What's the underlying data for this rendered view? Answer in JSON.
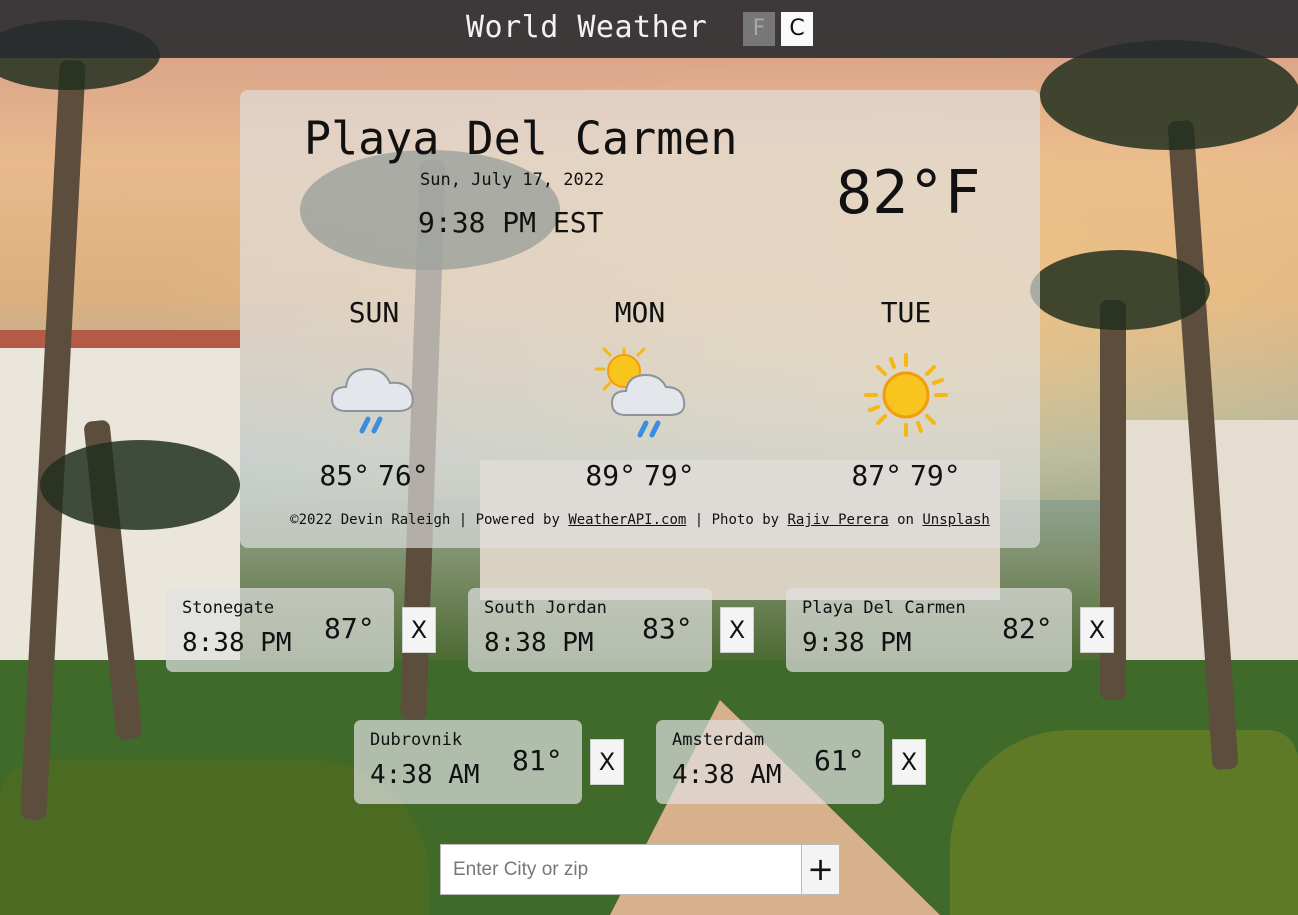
{
  "header": {
    "title": "World Weather",
    "unit_f": "F",
    "unit_c": "C",
    "active_unit": "F"
  },
  "current": {
    "city": "Playa Del Carmen",
    "date": "Sun, July 17, 2022",
    "time": "9:38 PM EST",
    "temp": "82°F"
  },
  "forecast": [
    {
      "day": "SUN",
      "icon": "rain-cloud-icon",
      "hi": "85°",
      "lo": "76°"
    },
    {
      "day": "MON",
      "icon": "sun-cloud-rain-icon",
      "hi": "89°",
      "lo": "79°"
    },
    {
      "day": "TUE",
      "icon": "sun-icon",
      "hi": "87°",
      "lo": "79°"
    }
  ],
  "footer": {
    "prefix": "©2022 Devin Raleigh | Powered by ",
    "api_link": "WeatherAPI.com",
    "photo_text": " | Photo by ",
    "photographer_link": "Rajiv Perera",
    "on_text": " on ",
    "unsplash_link": "Unsplash"
  },
  "saved_cities": [
    {
      "name": "Stonegate",
      "time": "8:38 PM",
      "temp": "87°",
      "remove": "X"
    },
    {
      "name": "South Jordan",
      "time": "8:38 PM",
      "temp": "83°",
      "remove": "X"
    },
    {
      "name": "Playa Del Carmen",
      "time": "9:38 PM",
      "temp": "82°",
      "remove": "X"
    },
    {
      "name": "Dubrovnik",
      "time": "4:38 AM",
      "temp": "81°",
      "remove": "X"
    },
    {
      "name": "Amsterdam",
      "time": "4:38 AM",
      "temp": "61°",
      "remove": "X"
    }
  ],
  "search": {
    "placeholder": "Enter City or zip",
    "value": "",
    "add_label": "+"
  },
  "colors": {
    "header_bg": "#282a2e",
    "sun": "#f7b614",
    "cloud": "#e3e6ea",
    "rain": "#3b8de0"
  }
}
